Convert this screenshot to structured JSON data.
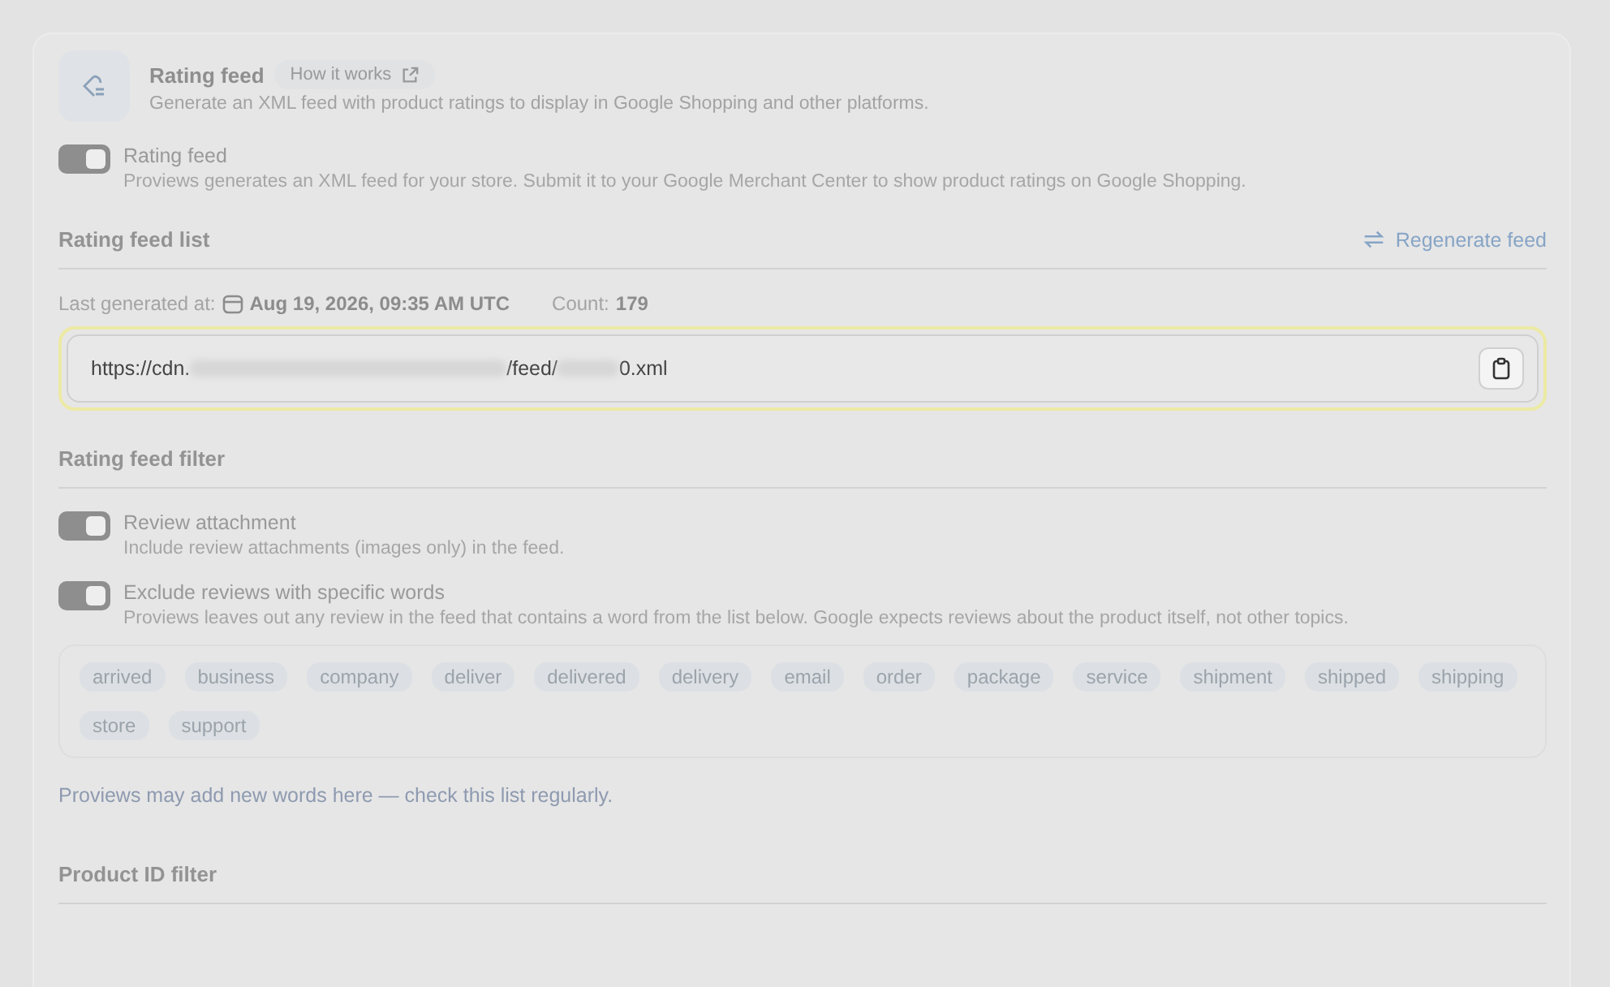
{
  "header": {
    "title": "Rating feed",
    "help_link": "How it works",
    "subtitle": "Generate an XML feed with product ratings to display in Google Shopping and other platforms."
  },
  "main_toggle": {
    "label": "Rating feed",
    "description": "Proviews generates an XML feed for your store. Submit it to your Google Merchant Center to show product ratings on Google Shopping.",
    "on": true
  },
  "feed_list": {
    "title": "Rating feed list",
    "regenerate": "Regenerate feed",
    "last_generated_label": "Last generated at:",
    "last_generated_value": "Aug 19, 2026, 09:35 AM UTC",
    "count_label": "Count:",
    "count_value": "179",
    "url_parts": [
      "https://cdn.",
      "/feed/",
      "0.xml"
    ]
  },
  "filter": {
    "title": "Rating feed filter",
    "toggles": [
      {
        "label": "Review attachment",
        "description": "Include review attachments (images only) in the feed.",
        "on": true
      },
      {
        "label": "Exclude reviews with specific words",
        "description": "Proviews leaves out any review in the feed that contains a word from the list below. Google expects reviews about the product itself, not other topics.",
        "on": true
      }
    ],
    "words": [
      "arrived",
      "business",
      "company",
      "deliver",
      "delivered",
      "delivery",
      "email",
      "order",
      "package",
      "service",
      "shipment",
      "shipped",
      "shipping",
      "store",
      "support"
    ],
    "note": "Proviews may add new words here — check this list regularly."
  },
  "product_filter": {
    "title": "Product ID filter"
  }
}
